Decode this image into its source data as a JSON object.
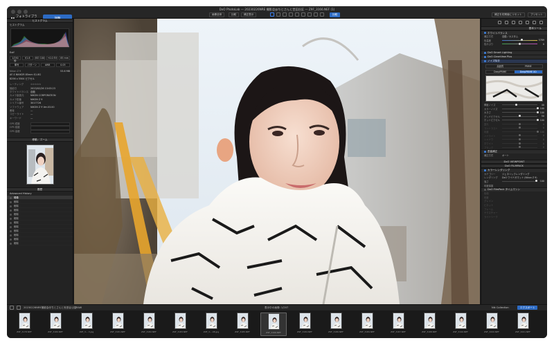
{
  "titlebar": {
    "window_title": "DxO PhotoLab — 20230226NRE 撮影会@ちとさんと世田谷区 — Z9F_3166.NEF (1)",
    "tab_photolibrary": "フォトライブラリ",
    "tab_customize": "調整",
    "tools": [
      "画像全体",
      "比較",
      "補正表示",
      "画像調整",
      "固有補正",
      "ローカル調整",
      "部分編集"
    ],
    "compare_button": "比較",
    "reset_button": "補正を初期値にリセット",
    "preset_button": "プリセット"
  },
  "left_panel": {
    "histogram_title": "ヒストグラム",
    "histogram_subtitle": "ヒストグラム",
    "exif_title": "Exif",
    "exif_values": [
      "1/250 秒",
      "f/1.8",
      "ISO 100",
      "+0.0 EV",
      "85 mm"
    ],
    "exif_values2": [
      "単写",
      "パターン",
      "AWB",
      "0.05"
    ],
    "camera": "Nikon Z 9",
    "camera_size": "53.6 MB",
    "lens_line": "AF-S NIKKOR 85mm f/1.8G",
    "dims_line": "8256 x 5504 ピクセル",
    "meta": [
      {
        "k": "レーティング",
        "v": "☆☆☆☆☆"
      },
      {
        "k": "撮影日",
        "v": "2023/02/26 13:03:23"
      },
      {
        "k": "ホワイトバランス",
        "v": "自動"
      },
      {
        "k": "カメラ製造元",
        "v": "NIKON CORPORATION"
      },
      {
        "k": "カメラ型番",
        "v": "NIKON Z 9"
      },
      {
        "k": "シリアル番号",
        "v": "3017726"
      },
      {
        "k": "ソフトウェア",
        "v": "NIKON Z 9 Ver.03.00"
      },
      {
        "k": "著者",
        "v": "—"
      },
      {
        "k": "コピーライト",
        "v": "—"
      },
      {
        "k": "キーワード",
        "v": "—"
      },
      {
        "k": "GPS 緯度",
        "v": ""
      },
      {
        "k": "GPS 経度",
        "v": ""
      },
      {
        "k": "GPS 高度",
        "v": ""
      }
    ],
    "navigator_title": "移動／ズーム",
    "history_title": "履歴",
    "history_subtitle": "Advanced History",
    "history_items": [
      "現像",
      "削除",
      "削除",
      "削除",
      "削除",
      "削除",
      "削除",
      "削除",
      "削除",
      "削除",
      "削除",
      "削除"
    ]
  },
  "right_panel": {
    "title": "基本ツール",
    "white_balance": "ホワイトバランス",
    "wb_preset_label": "補正方式",
    "wb_preset": "自動／カスタム",
    "wb_sliders": [
      {
        "label": "色温度",
        "value": "5789",
        "pos": 0.55
      },
      {
        "label": "色かぶり",
        "value": "0",
        "pos": 0.5
      }
    ],
    "smart_lighting": "DxO Smart Lighting",
    "clearview": "DxO ClearView Plus",
    "noise_header": "ノイズ除去",
    "denoise_modes": [
      "高品質",
      "PRIME",
      "DeepPRIME",
      "DeepPRIME XD"
    ],
    "denoise_selected": 3,
    "denoise_sliders": [
      {
        "label": "輝度ノイズ",
        "value": "40",
        "pos": 0.4
      },
      {
        "label": "カラーノイズ",
        "value": "100",
        "pos": 1.0
      },
      {
        "label": "大きさ",
        "value": "100",
        "pos": 1.0
      },
      {
        "label": "デッドピクセル",
        "value": "50",
        "pos": 0.5
      },
      {
        "label": "ホットピクセル",
        "value": "100",
        "pos": 1.0
      }
    ],
    "faded_sliders": [
      {
        "label": "露光",
        "value": "0",
        "pos": 0.5
      },
      {
        "label": "コントラスト",
        "value": "0",
        "pos": 0.5
      },
      {
        "label": "彩度",
        "value": "100",
        "pos": 1.0
      },
      {
        "label": "ハイライト",
        "value": "0",
        "pos": 0.5
      },
      {
        "label": "シャドウ",
        "value": "0",
        "pos": 0.5
      },
      {
        "label": "ホワイト",
        "value": "0",
        "pos": 0.5
      },
      {
        "label": "ブラック",
        "value": "0",
        "pos": 0.5
      }
    ],
    "dist_header": "歪曲補正",
    "dist_label": "補正方式",
    "dist_value": "オート",
    "viewpoint": "DxO VIEWPOINT",
    "filmpack": "DxO FILMPACK",
    "color_rendering": "カラーレンダリング",
    "cr_category_label": "カテゴリー",
    "cr_category": "ジェネリックレンダリング",
    "cr_render_label": "レンダリング",
    "cr_render": "DxO ワイドガマット (Nikon Z 9)",
    "cr_intensity_label": "強さ",
    "cr_intensity": "100",
    "protect_label": "彩度保護",
    "filmpack_tone": "DxO FilmPack タイムマシン",
    "more_items": [
      "色相",
      "彩度",
      "グレイン",
      "ビネット",
      "フレーム",
      "テクスチャー",
      "ライトリーク"
    ]
  },
  "bottombar": {
    "folder_path": "20230226NRE撮影会@ちとさんと世田谷公園RAW",
    "count_label": "表示中の画像: 1/207",
    "nik_label": "Nik Collection",
    "export_button": "エクスポート"
  },
  "filmstrip": [
    "Z9F_3178.NEF",
    "Z9F_3180.NEF",
    "Z9F_3-...3.jpg",
    "Z9F_3181.NEF",
    "Z9F_3182.NEF",
    "Z9F_3183.NEF",
    "Z9F_3-...98.jpg",
    "Z9F_3185.NEF",
    "Z9F_3166.NEF",
    "Z9F_3184.NEF",
    "Z9F_3186.NEF",
    "Z9F_3189.NEF",
    "Z9F_3187.NEF",
    "Z9F_3188.NEF",
    "Z9F_3190.NEF",
    "Z9F_3200.NEF",
    "Z9F_3201.NEF"
  ],
  "filmstrip_selected": 8
}
